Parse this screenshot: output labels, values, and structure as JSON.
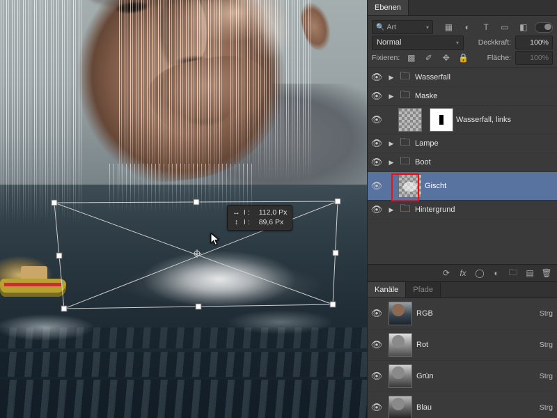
{
  "tooltip": {
    "w_glyph": "↔",
    "w_label": "I :",
    "w_value": "112,0 Px",
    "h_glyph": "↕",
    "h_label": "I :",
    "h_value": "89,6 Px"
  },
  "layersPanel": {
    "tab": "Ebenen",
    "filter_kind": "Art",
    "blend_mode": "Normal",
    "opacity_label": "Deckkraft:",
    "opacity_value": "100%",
    "lock_label": "Fixieren:",
    "fill_label": "Fläche:",
    "fill_value": "100%",
    "layers": [
      {
        "name": "Wasserfall"
      },
      {
        "name": "Maske"
      },
      {
        "name": "Wasserfall, links"
      },
      {
        "name": "Lampe"
      },
      {
        "name": "Boot"
      },
      {
        "name": "Gischt"
      },
      {
        "name": "Hintergrund"
      }
    ]
  },
  "channelsPanel": {
    "tabs": {
      "active": "Kanäle",
      "other": "Pfade"
    },
    "channels": [
      {
        "name": "RGB",
        "short": "Strg"
      },
      {
        "name": "Rot",
        "short": "Strg"
      },
      {
        "name": "Grün",
        "short": "Strg"
      },
      {
        "name": "Blau",
        "short": "Strg"
      }
    ]
  }
}
